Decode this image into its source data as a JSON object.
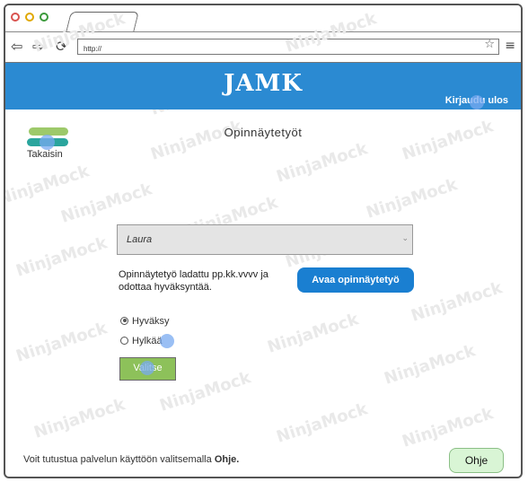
{
  "browser": {
    "url": "http://",
    "back_icon": "back-arrow-icon",
    "forward_icon": "forward-arrow-icon",
    "reload_icon": "reload-icon",
    "bookmark_icon": "star-icon",
    "menu_icon": "hamburger-menu-icon"
  },
  "header": {
    "brand": "JAMK",
    "logout_label": "Kirjaudu ulos",
    "color": "#2b8ad2"
  },
  "back": {
    "label": "Takaisin"
  },
  "page": {
    "title": "Opinnäytetyöt"
  },
  "student_select": {
    "selected": "Laura"
  },
  "thesis": {
    "info": "Opinnäytetyö ladattu pp.kk.vvvv ja odottaa hyväksyntää.",
    "open_button": "Avaa opinnäytetyö"
  },
  "decision": {
    "options": [
      {
        "label": "Hyväksy",
        "checked": true
      },
      {
        "label": "Hylkää",
        "checked": false
      }
    ],
    "submit_label": "Valitse"
  },
  "footer": {
    "text": "Voit tutustua palvelun käyttöön valitsemalla",
    "help_word": "Ohje.",
    "help_button": "Ohje"
  },
  "watermark": "NinjaMock"
}
